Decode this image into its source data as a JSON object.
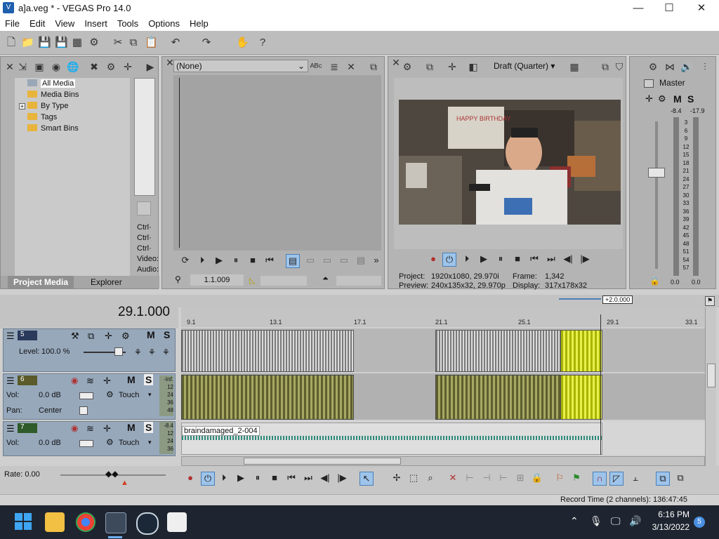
{
  "window": {
    "title": "a]a.veg * - VEGAS Pro 14.0",
    "min": "—",
    "max": "☐",
    "close": "✕"
  },
  "menu": [
    "File",
    "Edit",
    "View",
    "Insert",
    "Tools",
    "Options",
    "Help"
  ],
  "project_media": {
    "tree": [
      "All Media",
      "Media Bins",
      "By Type",
      "Tags",
      "Smart Bins"
    ],
    "tabs": [
      "Project Media",
      "Explorer"
    ],
    "side_labels": [
      "Ctrl·",
      "Ctrl·",
      "Ctrl·",
      "Video:",
      "Audio:"
    ]
  },
  "trimmer": {
    "select": "(None)",
    "time": "1.1.009"
  },
  "preview": {
    "quality": "Draft (Quarter)",
    "project_label": "Project:",
    "project_value": "1920x1080, 29.970i",
    "preview_label": "Preview:",
    "preview_value": "240x135x32, 29.970p",
    "frame_label": "Frame:",
    "frame_value": "1,342",
    "display_label": "Display:",
    "display_value": "317x178x32",
    "video_banner": "HAPPY BIRTHDAY"
  },
  "master": {
    "label": "Master",
    "m": "M",
    "s": "S",
    "peak_left": "-8.4",
    "peak_right": "-17.9",
    "scale": [
      "3",
      "6",
      "9",
      "12",
      "15",
      "18",
      "21",
      "24",
      "27",
      "30",
      "33",
      "36",
      "39",
      "42",
      "45",
      "48",
      "51",
      "54",
      "57"
    ],
    "readout_left": "0.0",
    "readout_right": "0.0"
  },
  "timeline": {
    "position": "29.1.000",
    "zoom_tag": "+2.0.000",
    "ruler": [
      "9.1",
      "13.1",
      "17.1",
      "21.1",
      "25.1",
      "29.1",
      "33.1"
    ],
    "tracks": [
      {
        "num": "5",
        "level_label": "Level:",
        "level_value": "100.0 %",
        "m": "M",
        "s": "S"
      },
      {
        "num": "6",
        "vol_label": "Vol:",
        "vol_value": "0.0 dB",
        "pan_label": "Pan:",
        "pan_value": "Center",
        "mode": "Touch",
        "m": "M",
        "s": "S",
        "meter_top": "-Inf.",
        "meter_marks": [
          "12",
          "24",
          "36",
          "48"
        ]
      },
      {
        "num": "7",
        "vol_label": "Vol:",
        "vol_value": "0.0 dB",
        "mode": "Touch",
        "m": "M",
        "s": "S",
        "meter_top": "-8.4",
        "meter_marks": [
          "12",
          "24",
          "36"
        ],
        "clip_name": "braindamaged_2-004"
      }
    ],
    "rate_label": "Rate: 0.00"
  },
  "status": {
    "record_time": "Record Time (2 channels): 136:47:45"
  },
  "taskbar": {
    "time": "6:16 PM",
    "date": "3/13/2022",
    "badge": "5"
  },
  "colors": {
    "accent": "#1e5fae",
    "selected_clip": "#d9e23a",
    "track_head": "#97a8bb"
  }
}
